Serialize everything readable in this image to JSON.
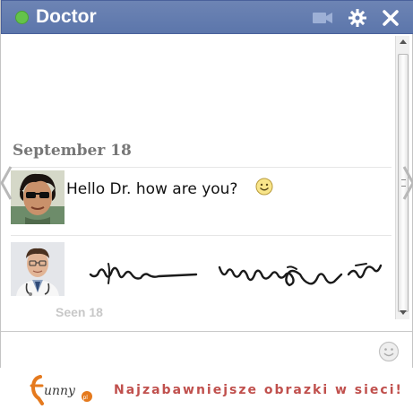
{
  "chat": {
    "title": "Doctor",
    "status": "online",
    "status_color": "#64c34a",
    "titlebar_color": "#6d84b4"
  },
  "messages": {
    "date_label": "September 18",
    "items": [
      {
        "sender": "patient",
        "avatar": "young-man-sunglasses-avatar",
        "text": "Hello Dr. how are you?",
        "emoticon": "smiley-icon"
      },
      {
        "sender": "doctor",
        "avatar": "doctor-avatar",
        "content": "illegible-handwriting-scribble"
      }
    ],
    "faded_text": "Seen 18"
  },
  "watermark": {
    "logo_text": "funny",
    "logo_suffix": ".pl",
    "slogan": "Najzabawniejsze obrazki w sieci!",
    "accent_color": "#e57a1e"
  }
}
